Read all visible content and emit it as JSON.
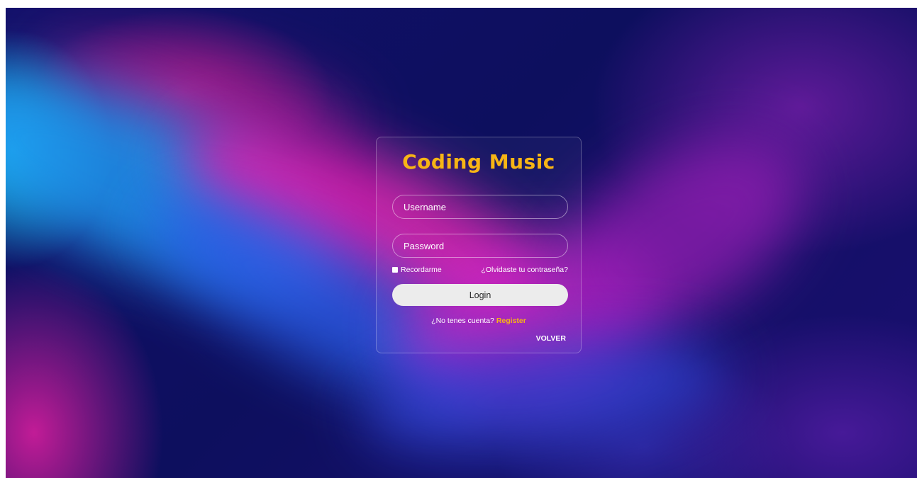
{
  "app": {
    "title": "Coding Music"
  },
  "login_form": {
    "username_placeholder": "Username",
    "password_placeholder": "Password",
    "remember_label": "Recordarme",
    "forgot_label": "¿Olvidaste tu contraseña?",
    "login_label": "Login",
    "no_account_text": "¿No tenes cuenta?",
    "register_label": "Register",
    "back_label": "VOLVER"
  },
  "theme": {
    "accent": "#f7b515",
    "button_bg": "#ececec",
    "background_base": "#0e0e62"
  },
  "icons": {
    "checkbox": "checkbox-icon"
  }
}
